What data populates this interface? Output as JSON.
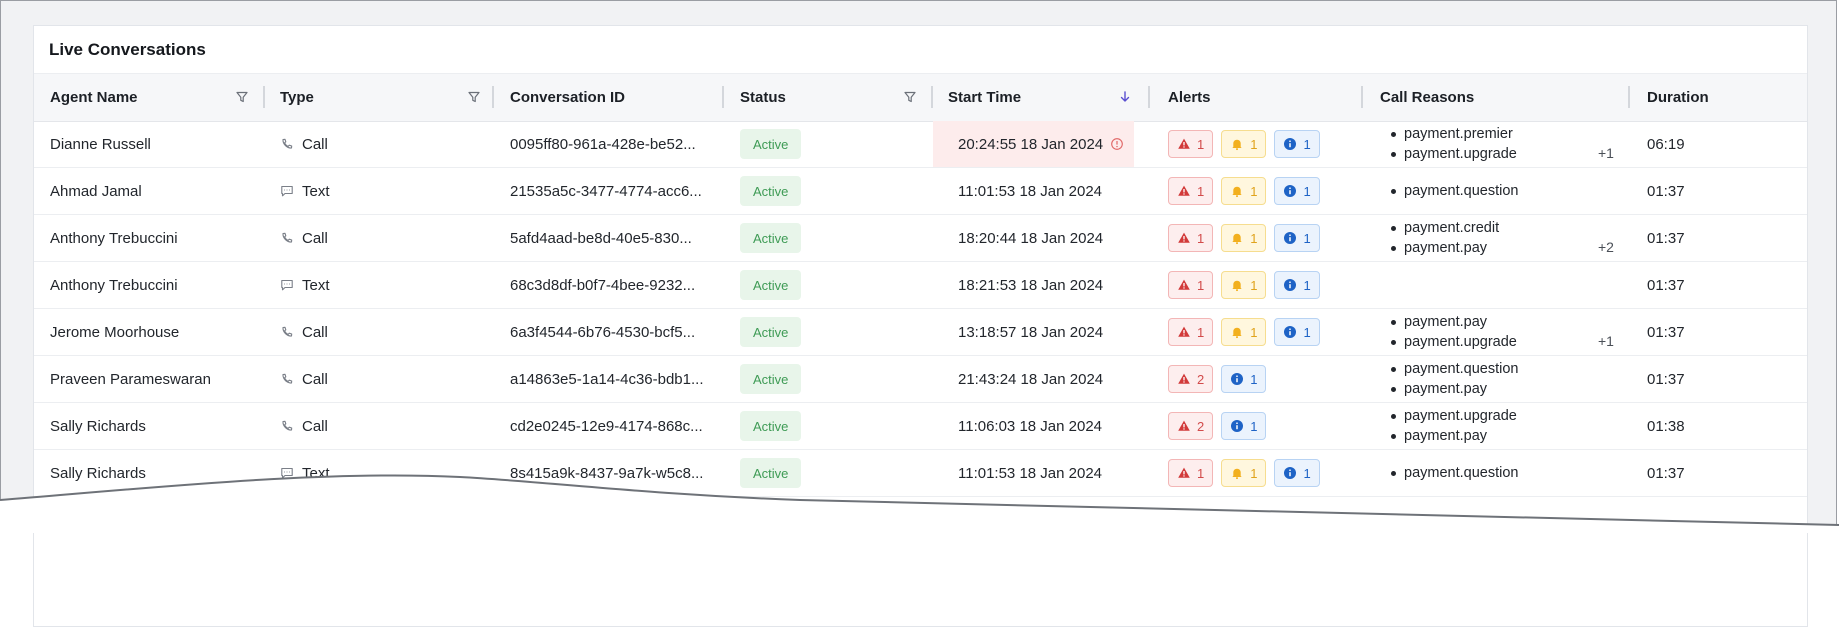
{
  "table": {
    "title": "Live Conversations",
    "columns": [
      {
        "label": "Agent Name",
        "icon": "filter-icon"
      },
      {
        "label": "Type",
        "icon": "filter-icon"
      },
      {
        "label": "Conversation ID"
      },
      {
        "label": "Status",
        "icon": "filter-icon"
      },
      {
        "label": "Start Time",
        "icon": "sort-descending-icon"
      },
      {
        "label": "Alerts"
      },
      {
        "label": "Call Reasons"
      },
      {
        "label": "Duration"
      }
    ],
    "rows": [
      {
        "agent": "Dianne Russell",
        "type": "Call",
        "type_icon": "phone-icon",
        "conv_id": "0095ff80-961a-428e-be52...",
        "status": "Active",
        "start": "20:24:55 18 Jan 2024",
        "start_warning": true,
        "alerts": [
          {
            "level": "red",
            "count": "1"
          },
          {
            "level": "yellow",
            "count": "1"
          },
          {
            "level": "blue",
            "count": "1"
          }
        ],
        "reasons": [
          "payment.premier",
          "payment.upgrade"
        ],
        "more": "+1",
        "duration": "06:19"
      },
      {
        "agent": "Ahmad Jamal",
        "type": "Text",
        "type_icon": "message-icon",
        "conv_id": "21535a5c-3477-4774-acc6...",
        "status": "Active",
        "start": "11:01:53 18 Jan 2024",
        "alerts": [
          {
            "level": "red",
            "count": "1"
          },
          {
            "level": "yellow",
            "count": "1"
          },
          {
            "level": "blue",
            "count": "1"
          }
        ],
        "reasons": [
          "payment.question"
        ],
        "more": "",
        "duration": "01:37"
      },
      {
        "agent": "Anthony Trebuccini",
        "type": "Call",
        "type_icon": "phone-icon",
        "conv_id": "5afd4aad-be8d-40e5-830...",
        "status": "Active",
        "start": "18:20:44 18 Jan 2024",
        "alerts": [
          {
            "level": "red",
            "count": "1"
          },
          {
            "level": "yellow",
            "count": "1"
          },
          {
            "level": "blue",
            "count": "1"
          }
        ],
        "reasons": [
          "payment.credit",
          "payment.pay"
        ],
        "more": "+2",
        "duration": "01:37"
      },
      {
        "agent": "Anthony Trebuccini",
        "type": "Text",
        "type_icon": "message-icon",
        "conv_id": "68c3d8df-b0f7-4bee-9232...",
        "status": "Active",
        "start": "18:21:53 18 Jan 2024",
        "alerts": [
          {
            "level": "red",
            "count": "1"
          },
          {
            "level": "yellow",
            "count": "1"
          },
          {
            "level": "blue",
            "count": "1"
          }
        ],
        "reasons": [],
        "more": "",
        "duration": "01:37"
      },
      {
        "agent": "Jerome Moorhouse",
        "type": "Call",
        "type_icon": "phone-icon",
        "conv_id": "6a3f4544-6b76-4530-bcf5...",
        "status": "Active",
        "start": "13:18:57 18 Jan 2024",
        "alerts": [
          {
            "level": "red",
            "count": "1"
          },
          {
            "level": "yellow",
            "count": "1"
          },
          {
            "level": "blue",
            "count": "1"
          }
        ],
        "reasons": [
          "payment.pay",
          "payment.upgrade"
        ],
        "more": "+1",
        "duration": "01:37"
      },
      {
        "agent": "Praveen Parameswaran",
        "type": "Call",
        "type_icon": "phone-icon",
        "conv_id": "a14863e5-1a14-4c36-bdb1...",
        "status": "Active",
        "start": "21:43:24 18 Jan 2024",
        "alerts": [
          {
            "level": "red",
            "count": "2"
          },
          {
            "level": "blue",
            "count": "1"
          }
        ],
        "reasons": [
          "payment.question",
          "payment.pay"
        ],
        "more": "",
        "duration": "01:37"
      },
      {
        "agent": "Sally Richards",
        "type": "Call",
        "type_icon": "phone-icon",
        "conv_id": "cd2e0245-12e9-4174-868c...",
        "status": "Active",
        "start": "11:06:03 18 Jan 2024",
        "alerts": [
          {
            "level": "red",
            "count": "2"
          },
          {
            "level": "blue",
            "count": "1"
          }
        ],
        "reasons": [
          "payment.upgrade",
          "payment.pay"
        ],
        "more": "",
        "duration": "01:38"
      },
      {
        "agent": "Sally Richards",
        "type": "Text",
        "type_icon": "message-icon",
        "conv_id": "8s415a9k-8437-9a7k-w5c8...",
        "status": "Active",
        "start": "11:01:53 18 Jan 2024",
        "alerts": [
          {
            "level": "red",
            "count": "1"
          },
          {
            "level": "yellow",
            "count": "1"
          },
          {
            "level": "blue",
            "count": "1"
          }
        ],
        "reasons": [
          "payment.question"
        ],
        "more": "",
        "duration": "01:37"
      }
    ]
  },
  "colors": {
    "active_bg": "#e8f5ea",
    "active_text": "#3e9b55",
    "highlight_bg": "#fdecec",
    "alert_red": "#d24b4b",
    "alert_yellow": "#e0a31b",
    "alert_blue": "#1e63c6"
  }
}
